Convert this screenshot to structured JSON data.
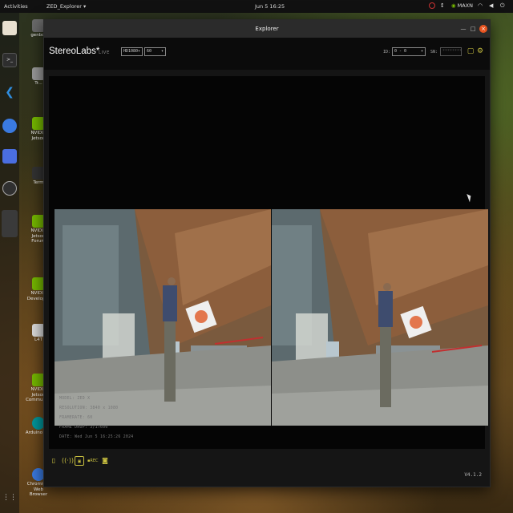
{
  "topbar": {
    "activities": "Activities",
    "app_menu": "ZED_Explorer ▾",
    "clock": "Jun 5  16:25",
    "nvidia_label": "MAXN"
  },
  "desktop_icons": [
    {
      "label": "genbot"
    },
    {
      "label": "Tr..."
    },
    {
      "label": "NVIDIA Jetson"
    },
    {
      "label": "Term"
    },
    {
      "label": "NVIDIA Jetson Forum"
    },
    {
      "label": "NVIDIA Developer"
    },
    {
      "label": "L4T"
    },
    {
      "label": "NVIDIA Jetson Community"
    },
    {
      "label": "Arduino IDE"
    },
    {
      "label": "Chromium Web Browser"
    }
  ],
  "window": {
    "title": "Explorer",
    "logo": "StereoLabs*",
    "live": "LIVE",
    "resolution_select": "HD1080",
    "fps_select": "60",
    "id_label": "ID:",
    "id_select": "0 - 0",
    "sn_label": "SN:",
    "sn_value": "********"
  },
  "overlay": {
    "model": "MODEL: ZED X",
    "resolution": "RESOLUTION: 3840 x 1080",
    "framerate": "FRAMERATE: 60",
    "frame_drop": "FRAME DROP: 3/17600",
    "date": "DATE: Wed Jun 5 16:25:26 2024"
  },
  "footer": {
    "version": "V4.1.2"
  },
  "colors": {
    "accent": "#c9c040",
    "close": "#e95420",
    "nvidia": "#76b900"
  }
}
